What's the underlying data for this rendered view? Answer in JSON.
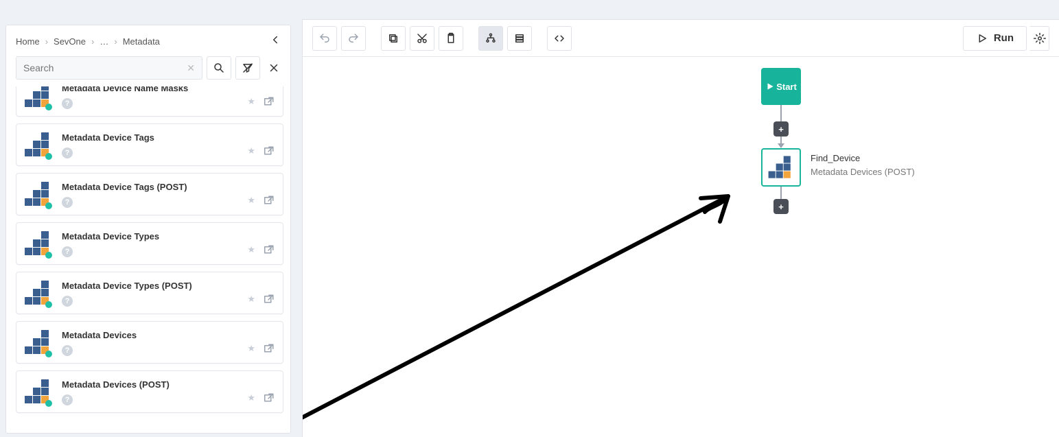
{
  "breadcrumb": {
    "home": "Home",
    "l1": "SevOne",
    "l2": "…",
    "l3": "Metadata"
  },
  "search": {
    "placeholder": "Search"
  },
  "sidebar_items": [
    {
      "title": "Metadata Device Name Masks"
    },
    {
      "title": "Metadata Device Tags"
    },
    {
      "title": "Metadata Device Tags (POST)"
    },
    {
      "title": "Metadata Device Types"
    },
    {
      "title": "Metadata Device Types (POST)"
    },
    {
      "title": "Metadata Devices"
    },
    {
      "title": "Metadata Devices (POST)"
    }
  ],
  "toolbar": {
    "run_label": "Run"
  },
  "flow": {
    "start_label": "Start",
    "step_name": "Find_Device",
    "step_type": "Metadata Devices (POST)"
  }
}
